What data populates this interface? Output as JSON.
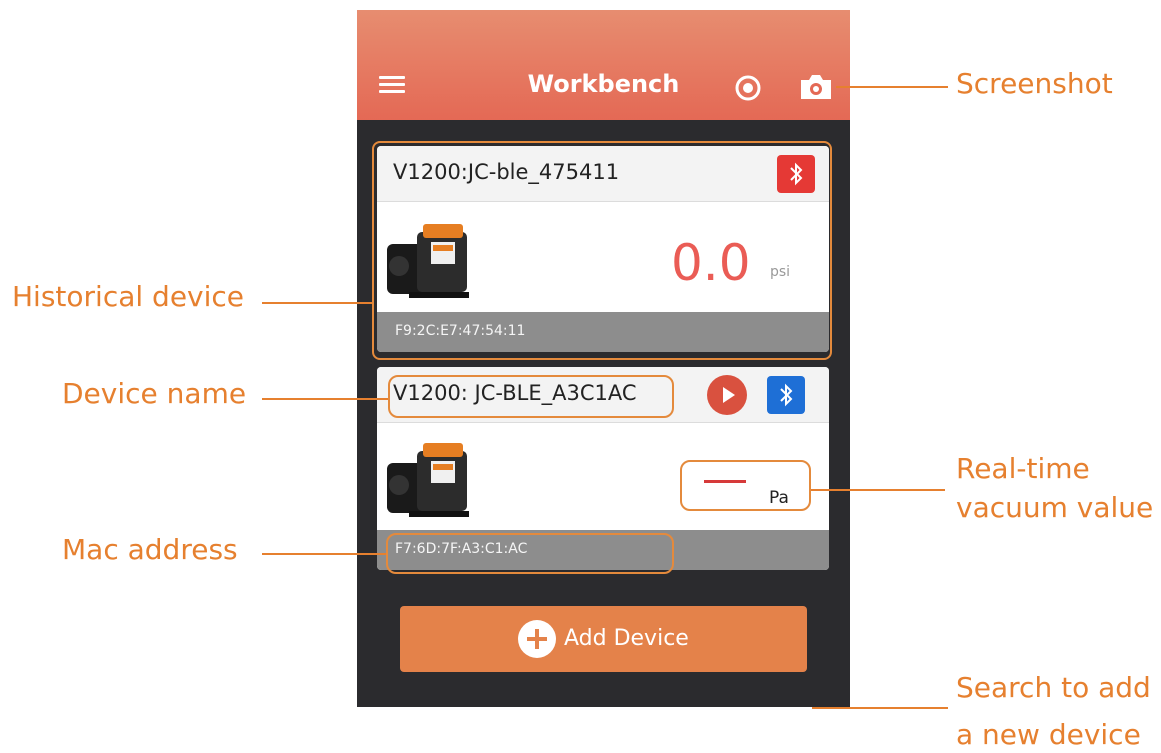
{
  "app": {
    "title": "Workbench",
    "menu_icon": "hamburger-menu-icon",
    "record_icon": "record-icon",
    "camera_icon": "camera-icon"
  },
  "devices": [
    {
      "name": "V1200:JC-ble_475411",
      "bluetooth_color": "#e53935",
      "reading": "0.0",
      "unit": "psi",
      "mac": "F9:2C:E7:47:54:11"
    },
    {
      "name": "V1200: JC-BLE_A3C1AC",
      "bluetooth_color": "#1e6fd6",
      "reading": "---",
      "unit": "Pa",
      "mac": "F7:6D:7F:A3:C1:AC"
    }
  ],
  "add_device": {
    "label": "Add Device"
  },
  "annotations": {
    "screenshot": "Screenshot",
    "historical_device": "Historical device",
    "device_name": "Device name",
    "realtime_line1": "Real-time",
    "realtime_line2": "vacuum value",
    "mac_address": "Mac address",
    "search_line1": "Search to add",
    "search_line2": "a new device"
  },
  "colors": {
    "appbar_top": "#e78d70",
    "appbar_bottom": "#e46955",
    "accent_orange": "#e6802f",
    "add_button": "#e4824a",
    "phone_bg": "#2b2b2e"
  }
}
